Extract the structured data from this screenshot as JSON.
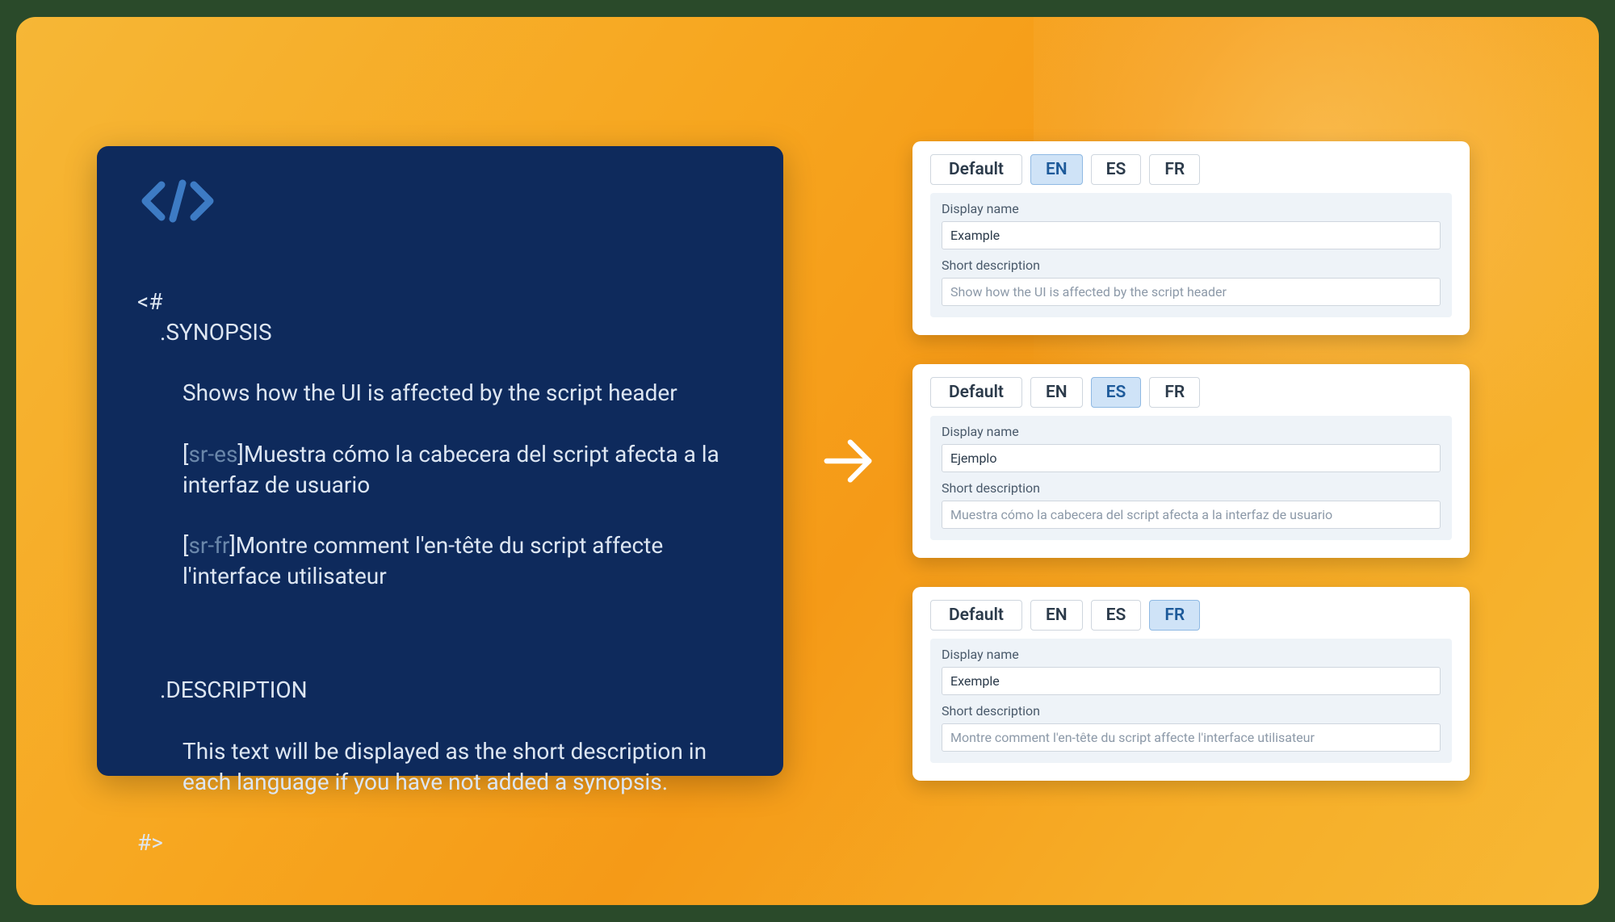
{
  "code": {
    "open": "<#",
    "synopsis_kw": ".SYNOPSIS",
    "synopsis_en": "Shows how the UI is affected by the script header",
    "tag_es_open": "[",
    "tag_es": "sr-es",
    "tag_es_close": "]",
    "synopsis_es": "Muestra cómo la cabecera del script afecta a la interfaz de usuario",
    "tag_fr_open": "[",
    "tag_fr": "sr-fr",
    "tag_fr_close": "]",
    "synopsis_fr": "Montre comment l'en-tête du script affecte l'interface utilisateur",
    "description_kw": ".DESCRIPTION",
    "description_text": "This text will be displayed as the short description in each language if you have not added a synopsis.",
    "close": "#>"
  },
  "labels": {
    "default": "Default",
    "en": "EN",
    "es": "ES",
    "fr": "FR",
    "display_name": "Display name",
    "short_description": "Short description"
  },
  "cards": {
    "en": {
      "display_name": "Example",
      "short_description": "Show how the UI is affected by the script header"
    },
    "es": {
      "display_name": "Ejemplo",
      "short_description": "Muestra cómo la cabecera del script afecta a la interfaz de usuario"
    },
    "fr": {
      "display_name": "Exemple",
      "short_description": "Montre comment l'en-tête du script affecte l'interface utilisateur"
    }
  }
}
